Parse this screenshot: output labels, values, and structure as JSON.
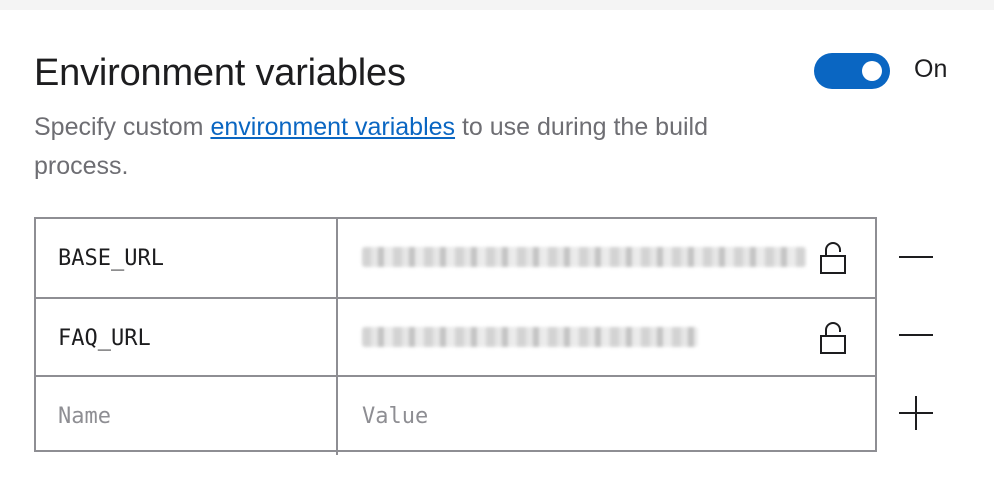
{
  "section": {
    "title": "Environment variables",
    "description_prefix": "Specify custom ",
    "description_link": "environment variables",
    "description_suffix": " to use during the build process."
  },
  "toggle": {
    "state": "On",
    "enabled": true,
    "color": "#0a66c2"
  },
  "variables": [
    {
      "name": "BASE_URL",
      "value_hidden": true,
      "icon": "unlock-icon",
      "action_icon": "minus-icon"
    },
    {
      "name": "FAQ_URL",
      "value_hidden": true,
      "icon": "unlock-icon",
      "action_icon": "minus-icon"
    }
  ],
  "new_row": {
    "name_placeholder": "Name",
    "value_placeholder": "Value",
    "action_icon": "plus-icon"
  }
}
